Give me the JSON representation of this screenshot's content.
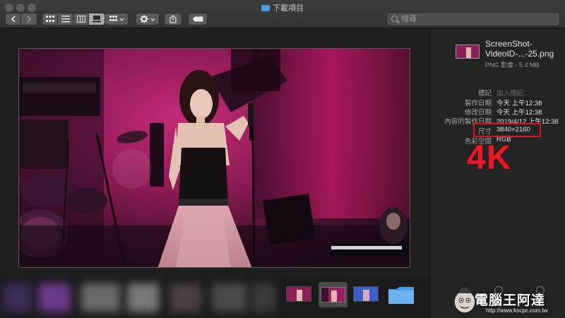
{
  "window": {
    "title": "下載項目"
  },
  "toolbar": {
    "search_placeholder": "搜尋"
  },
  "info": {
    "filename": "ScreenShot-VideoID-...-25.png",
    "filetype": "PNG 影像 - 5.4 MB",
    "rows": [
      {
        "key": "標記",
        "value": "加入標記..."
      },
      {
        "key": "製作日期",
        "value": "今天 上午12:38"
      },
      {
        "key": "修改日期",
        "value": "今天 上午12:38"
      },
      {
        "key": "內容的製作日期",
        "value": "2019/4/12 上午12:38"
      },
      {
        "key": "尺寸",
        "value": "3840×2160"
      },
      {
        "key": "色彩空間",
        "value": "RGB"
      }
    ]
  },
  "annotation": {
    "label": "4K"
  },
  "watermark": {
    "text": "電腦王阿達",
    "url": "http://www.kocpc.com.tw"
  },
  "colors": {
    "highlight": "#e0141e",
    "stage_magenta": "#b0185a",
    "folder_blue": "#4a9ee0"
  }
}
